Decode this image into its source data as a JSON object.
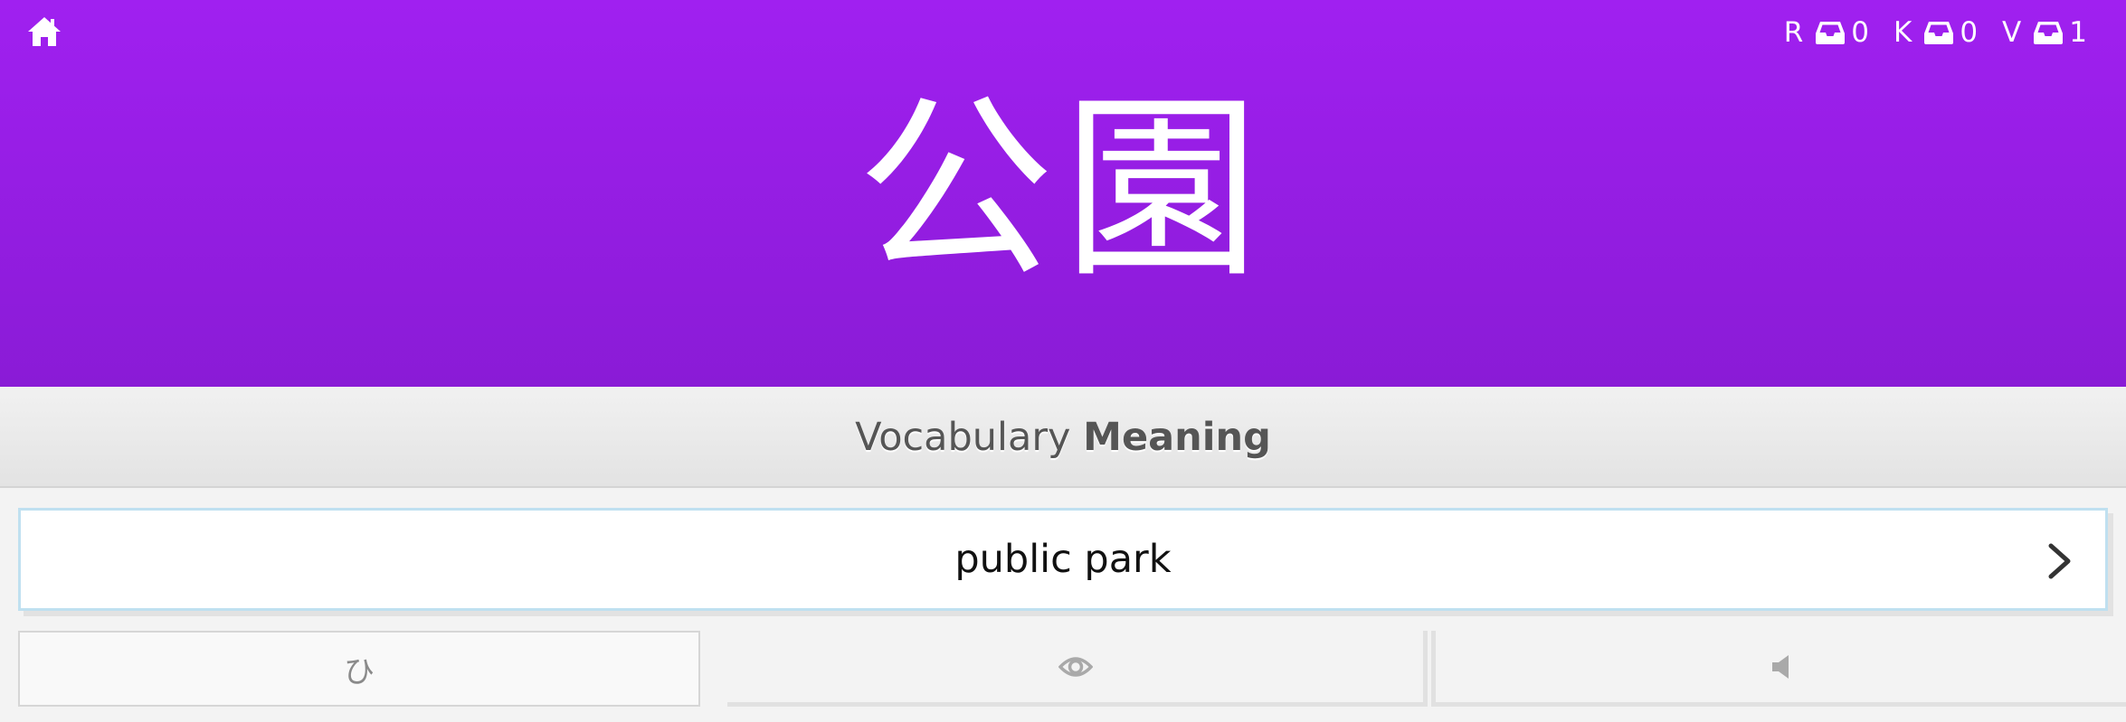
{
  "header": {
    "home_icon": "home-icon",
    "word": "公園",
    "counts": [
      {
        "letter": "R",
        "icon": "inbox-icon",
        "value": "0"
      },
      {
        "letter": "K",
        "icon": "inbox-icon",
        "value": "0"
      },
      {
        "letter": "V",
        "icon": "inbox-icon",
        "value": "1"
      }
    ],
    "color_top": "#a020f0",
    "color_bottom": "#8a1bd6"
  },
  "question_type": {
    "category": "Vocabulary",
    "kind": "Meaning"
  },
  "answer": {
    "value": "public park",
    "submit_icon": "chevron-right-icon"
  },
  "actions": {
    "kana_label": "ひ",
    "eye_icon": "eye-icon",
    "audio_icon": "speaker-icon"
  }
}
